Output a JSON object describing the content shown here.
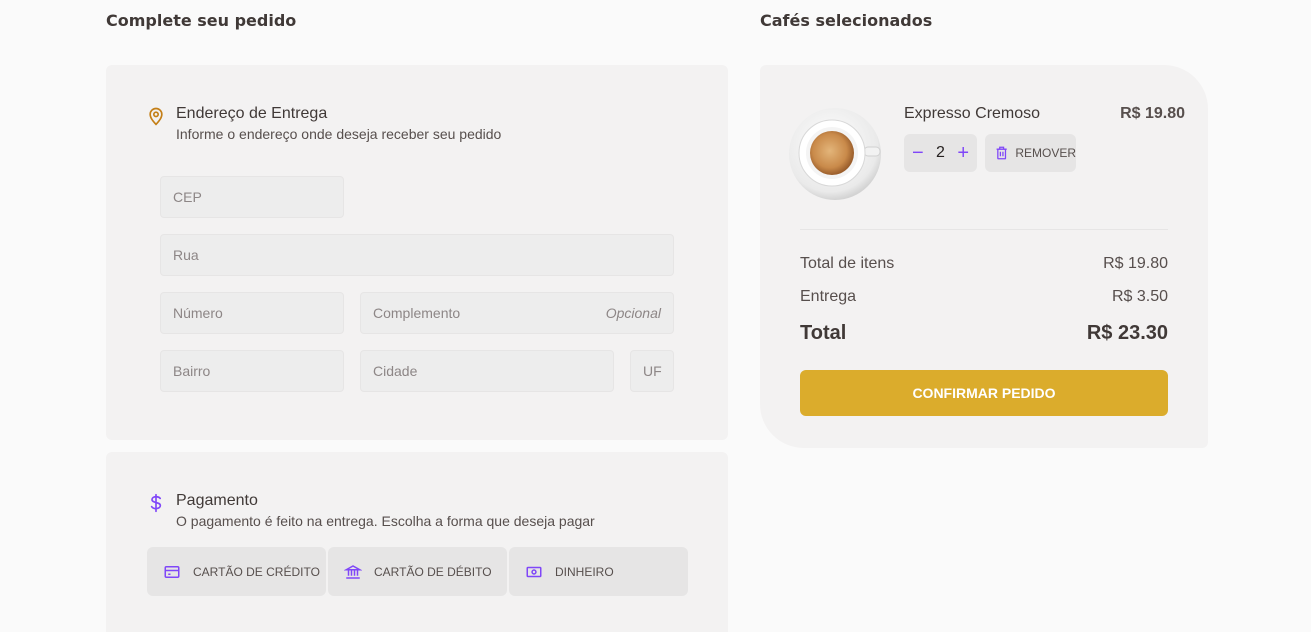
{
  "titles": {
    "order": "Complete seu pedido",
    "selected": "Cafés selecionados"
  },
  "address": {
    "title": "Endereço de Entrega",
    "subtitle": "Informe o endereço onde deseja receber seu pedido",
    "icon": "map-pin-icon",
    "fields": {
      "cep": "CEP",
      "rua": "Rua",
      "numero": "Número",
      "complemento": "Complemento",
      "complemento_hint": "Opcional",
      "bairro": "Bairro",
      "cidade": "Cidade",
      "uf": "UF"
    }
  },
  "payment": {
    "title": "Pagamento",
    "subtitle": "O pagamento é feito na entrega. Escolha a forma que deseja pagar",
    "icon": "dollar-icon",
    "options": [
      {
        "label": "CARTÃO DE CRÉDITO",
        "icon": "credit-card-icon"
      },
      {
        "label": "CARTÃO DE DÉBITO",
        "icon": "bank-icon"
      },
      {
        "label": "DINHEIRO",
        "icon": "money-icon"
      }
    ]
  },
  "cart": {
    "item": {
      "name": "Expresso Cremoso",
      "price": "R$ 19.80",
      "quantity": "2",
      "remove_label": "REMOVER",
      "image": "coffee-cup-image"
    },
    "summary": {
      "items_label": "Total de itens",
      "items_value": "R$ 19.80",
      "delivery_label": "Entrega",
      "delivery_value": "R$ 3.50",
      "total_label": "Total",
      "total_value": "R$ 23.30"
    },
    "confirm_label": "CONFIRMAR PEDIDO"
  },
  "colors": {
    "accent_purple": "#8047F8",
    "accent_yellow_dark": "#C47F17",
    "confirm_yellow": "#DBAC2C",
    "card_bg": "#F3F2F2"
  }
}
